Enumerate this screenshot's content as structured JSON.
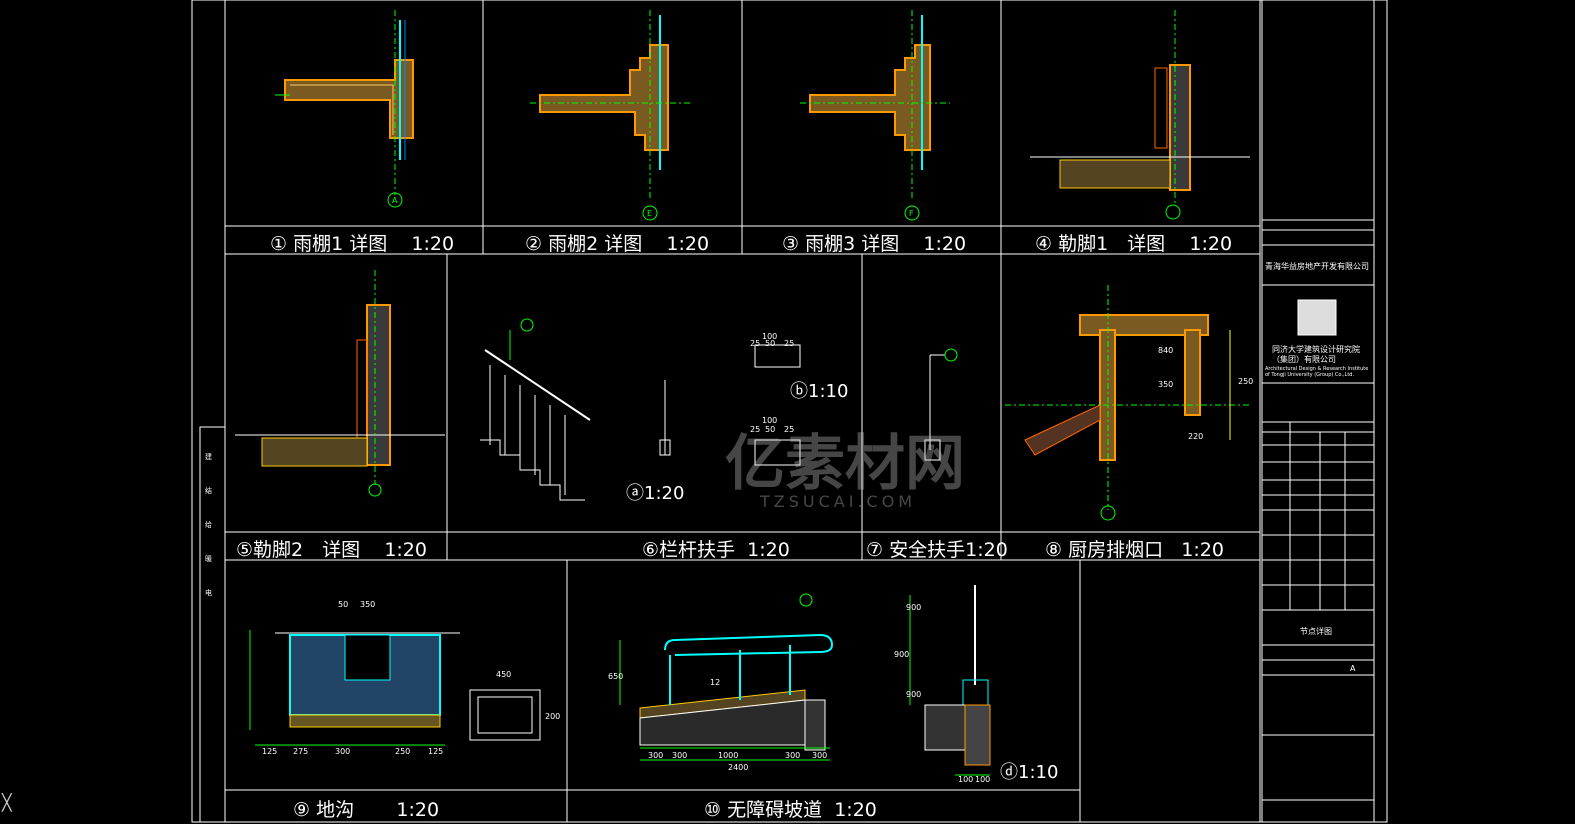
{
  "colors": {
    "background": "#000000",
    "frame": "#ffffff",
    "wall_fill": "#c8a050",
    "insulation": "#ff9900",
    "glass": "#00ffff",
    "axis": "#00ff00",
    "dimension": "#ffff00",
    "leader": "#00ff00",
    "watermark": "rgba(200,200,200,0.35)"
  },
  "details": [
    {
      "no": "①",
      "title": "雨棚1 详图",
      "scale": "1:20"
    },
    {
      "no": "②",
      "title": "雨棚2 详图",
      "scale": "1:20"
    },
    {
      "no": "③",
      "title": "雨棚3 详图",
      "scale": "1:20"
    },
    {
      "no": "④",
      "title": "勒脚1　详图",
      "scale": "1:20"
    },
    {
      "no": "⑤",
      "title": "勒脚2　详图",
      "scale": "1:20"
    },
    {
      "no": "⑥",
      "title": "栏杆扶手",
      "scale": "1:20"
    },
    {
      "no": "⑦",
      "title": "安全扶手",
      "scale": "1:20"
    },
    {
      "no": "⑧",
      "title": "厨房排烟口",
      "scale": "1:20"
    },
    {
      "no": "⑨",
      "title": "地沟",
      "scale": "1:20"
    },
    {
      "no": "⑩",
      "title": "无障碍坡道",
      "scale": "1:20"
    }
  ],
  "sub_scales": {
    "b": "1:10",
    "a": "1:20",
    "d": "1:10"
  },
  "axis_labels": [
    "A",
    "E",
    "F"
  ],
  "dimensions": {
    "trench": [
      "125",
      "275",
      "300",
      "250",
      "125",
      "350",
      "50",
      "450",
      "200"
    ],
    "ramp": [
      "300",
      "300",
      "1000",
      "300",
      "300",
      "2400",
      "650",
      "900",
      "12"
    ],
    "handrail_b": [
      "100",
      "25",
      "50",
      "25",
      "100",
      "25",
      "50",
      "25"
    ],
    "chimney": [
      "840",
      "350",
      "220",
      "250"
    ],
    "rail_d": [
      "900",
      "100",
      "100",
      "900"
    ]
  },
  "title_block": {
    "owner": "青海华益房地产开发有限公司",
    "institute_cn": "同济大学建筑设计研究院（集团）有限公司",
    "institute_en": "Architectural Design & Research Institute of Tongji University (Group) Co.,Ltd.",
    "drawing_title": "节点详图",
    "sheet_no": "A",
    "left_stamp_labels": [
      "建",
      "筑",
      "结",
      "构",
      "给",
      "排",
      "水",
      "暖",
      "通",
      "电",
      "气"
    ]
  },
  "watermark": {
    "brand": "亿素材网",
    "url": "TZSUCAI.COM"
  }
}
